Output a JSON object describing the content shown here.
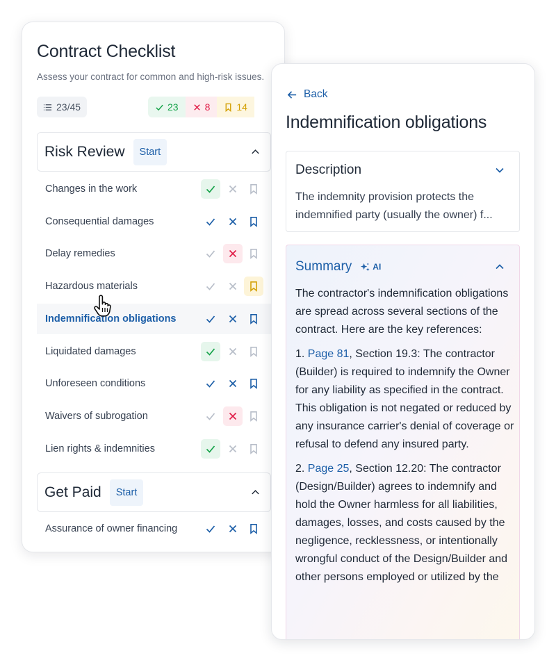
{
  "checklist": {
    "title": "Contract Checklist",
    "subtitle": "Assess your contract for common and high-risk issues.",
    "progress": "23/45",
    "stats": {
      "passed": "23",
      "failed": "8",
      "flagged": "14"
    },
    "sections": [
      {
        "title": "Risk Review",
        "start_label": "Start",
        "items": [
          {
            "label": "Changes in the work",
            "status": "passed"
          },
          {
            "label": "Consequential damages",
            "status": "none"
          },
          {
            "label": "Delay remedies",
            "status": "failed"
          },
          {
            "label": "Hazardous materials",
            "status": "flagged"
          },
          {
            "label": "Indemnification obligations",
            "status": "none",
            "active": true
          },
          {
            "label": "Liquidated damages",
            "status": "passed"
          },
          {
            "label": "Unforeseen conditions",
            "status": "none"
          },
          {
            "label": "Waivers of subrogation",
            "status": "failed"
          },
          {
            "label": "Lien rights & indemnities",
            "status": "passed"
          }
        ]
      },
      {
        "title": "Get Paid",
        "start_label": "Start",
        "items": [
          {
            "label": "Assurance of owner financing",
            "status": "none"
          }
        ]
      }
    ]
  },
  "detail": {
    "back_label": "Back",
    "title": "Indemnification obligations",
    "description": {
      "heading": "Description",
      "text": "The indemnity provision protects the indemnified party (usually the owner) f..."
    },
    "summary": {
      "heading": "Summary",
      "ai_label": "AI",
      "intro": "The contractor's indemnification obligations are spread across several sections of the contract. Here are the key references:",
      "refs": [
        {
          "num": "1.",
          "link": "Page 81",
          "text": ", Section 19.3: The contractor (Builder) is required to indemnify the Owner for any liability as specified in the contract. This obligation is not negated or reduced by any insurance carrier's denial of coverage or refusal to defend any insured party."
        },
        {
          "num": "2.",
          "link": "Page 25",
          "text": ", Section 12.20: The contractor (Design/Builder) agrees to indemnify and hold the Owner harmless for all liabilities, damages, losses, and costs caused by the negligence, recklessness, or intentionally wrongful conduct of the Design/Builder and other persons employed or utilized by the"
        }
      ]
    }
  },
  "colors": {
    "accent": "#1d5fa8",
    "passed": "#16a34a",
    "failed": "#e11d48",
    "flagged": "#d4a106"
  }
}
